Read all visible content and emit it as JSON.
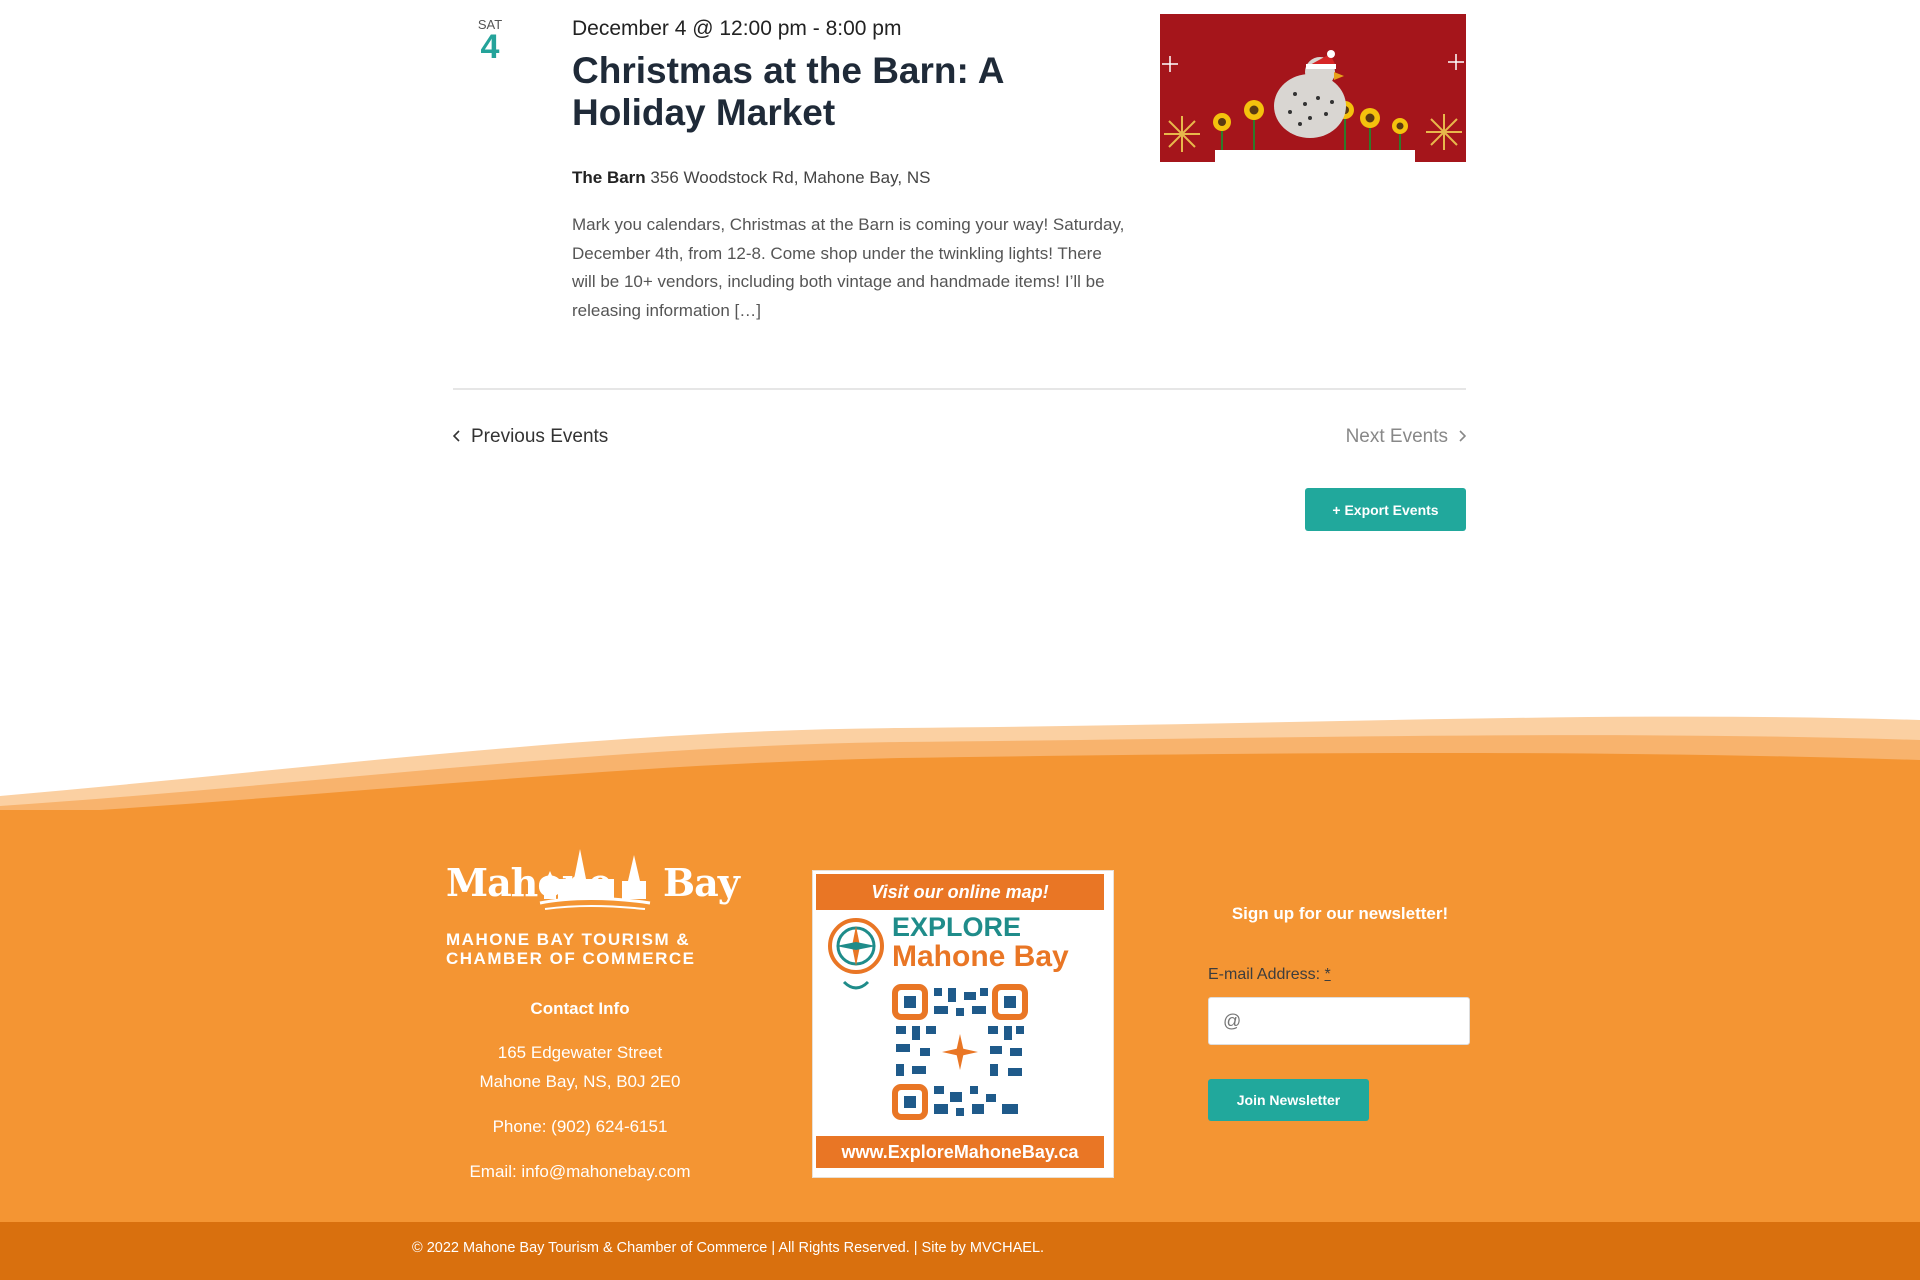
{
  "event": {
    "day_abbr": "SAT",
    "day_num": "4",
    "datetime": "December 4 @ 12:00 pm - 8:00 pm",
    "title": "Christmas at the Barn: A Holiday Market",
    "venue_name": "The Barn",
    "venue_address": "356 Woodstock Rd, Mahone Bay, NS",
    "description": "Mark you calendars, Christmas at the Barn is coming your way! Saturday, December 4th, from 12-8. Come shop under the twinkling lights! There will be 10+ vendors, including both vintage and handmade items! I’ll be releasing information […]"
  },
  "nav": {
    "previous_label": "Previous Events",
    "next_label": "Next Events",
    "export_label": "+ Export Events"
  },
  "footer": {
    "logo_text": "Mahone Bay",
    "logo_sub1": "MAHONE BAY TOURISM &",
    "logo_sub2": "CHAMBER OF COMMERCE",
    "contact_heading": "Contact Info",
    "address_line1": "165 Edgewater Street",
    "address_line2": "Mahone Bay, NS, B0J 2E0",
    "phone": "Phone: (902) 624-6151",
    "email": "Email: info@mahonebay.com",
    "qr_top_text": "Visit our online map!",
    "qr_explore": "EXPLORE",
    "qr_place": "Mahone Bay",
    "qr_url": "www.ExploreMahoneBay.ca",
    "newsletter_heading": "Sign up for our newsletter!",
    "email_label": "E-mail Address:",
    "email_required": "*",
    "email_placeholder": "@",
    "join_label": "Join Newsletter",
    "copyright": "© 2022 Mahone Bay Tourism & Chamber of Commerce | All Rights Reserved. | Site by MVCHAEL."
  },
  "colors": {
    "accent_teal": "#21a89c",
    "footer_orange": "#f49533",
    "bottom_bar": "#d9700e",
    "thumb_red": "#a5151b"
  }
}
